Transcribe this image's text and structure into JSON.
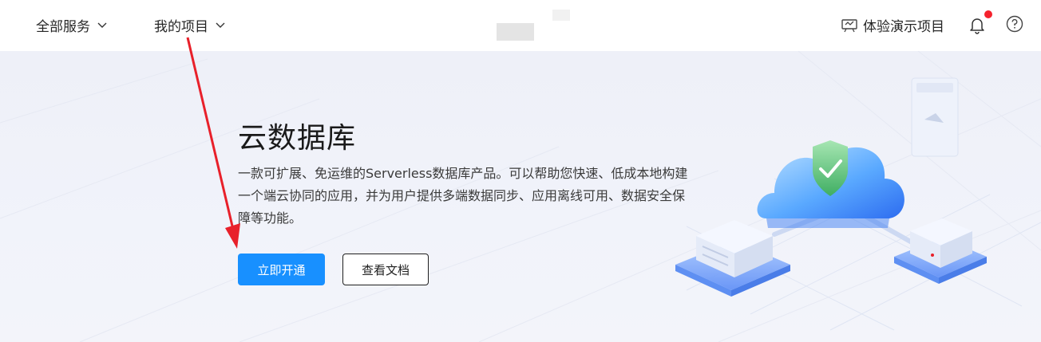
{
  "topbar": {
    "all_services": "全部服务",
    "my_projects": "我的项目",
    "demo_project": "体验演示项目",
    "notification_dot_color": "#f5222d"
  },
  "hero": {
    "title": "云数据库",
    "description": "一款可扩展、免运维的Serverless数据库产品。可以帮助您快速、低成本地构建一个端云协同的应用，并为用户提供多端数据同步、应用离线可用、数据安全保障等功能。",
    "primary_button": "立即开通",
    "secondary_button": "查看文档"
  },
  "colors": {
    "primary": "#1890ff",
    "annotation_arrow": "#e8202a"
  },
  "icons": [
    "chevron-down-icon",
    "demo-icon",
    "bell-icon",
    "help-icon",
    "shield-check-icon"
  ]
}
